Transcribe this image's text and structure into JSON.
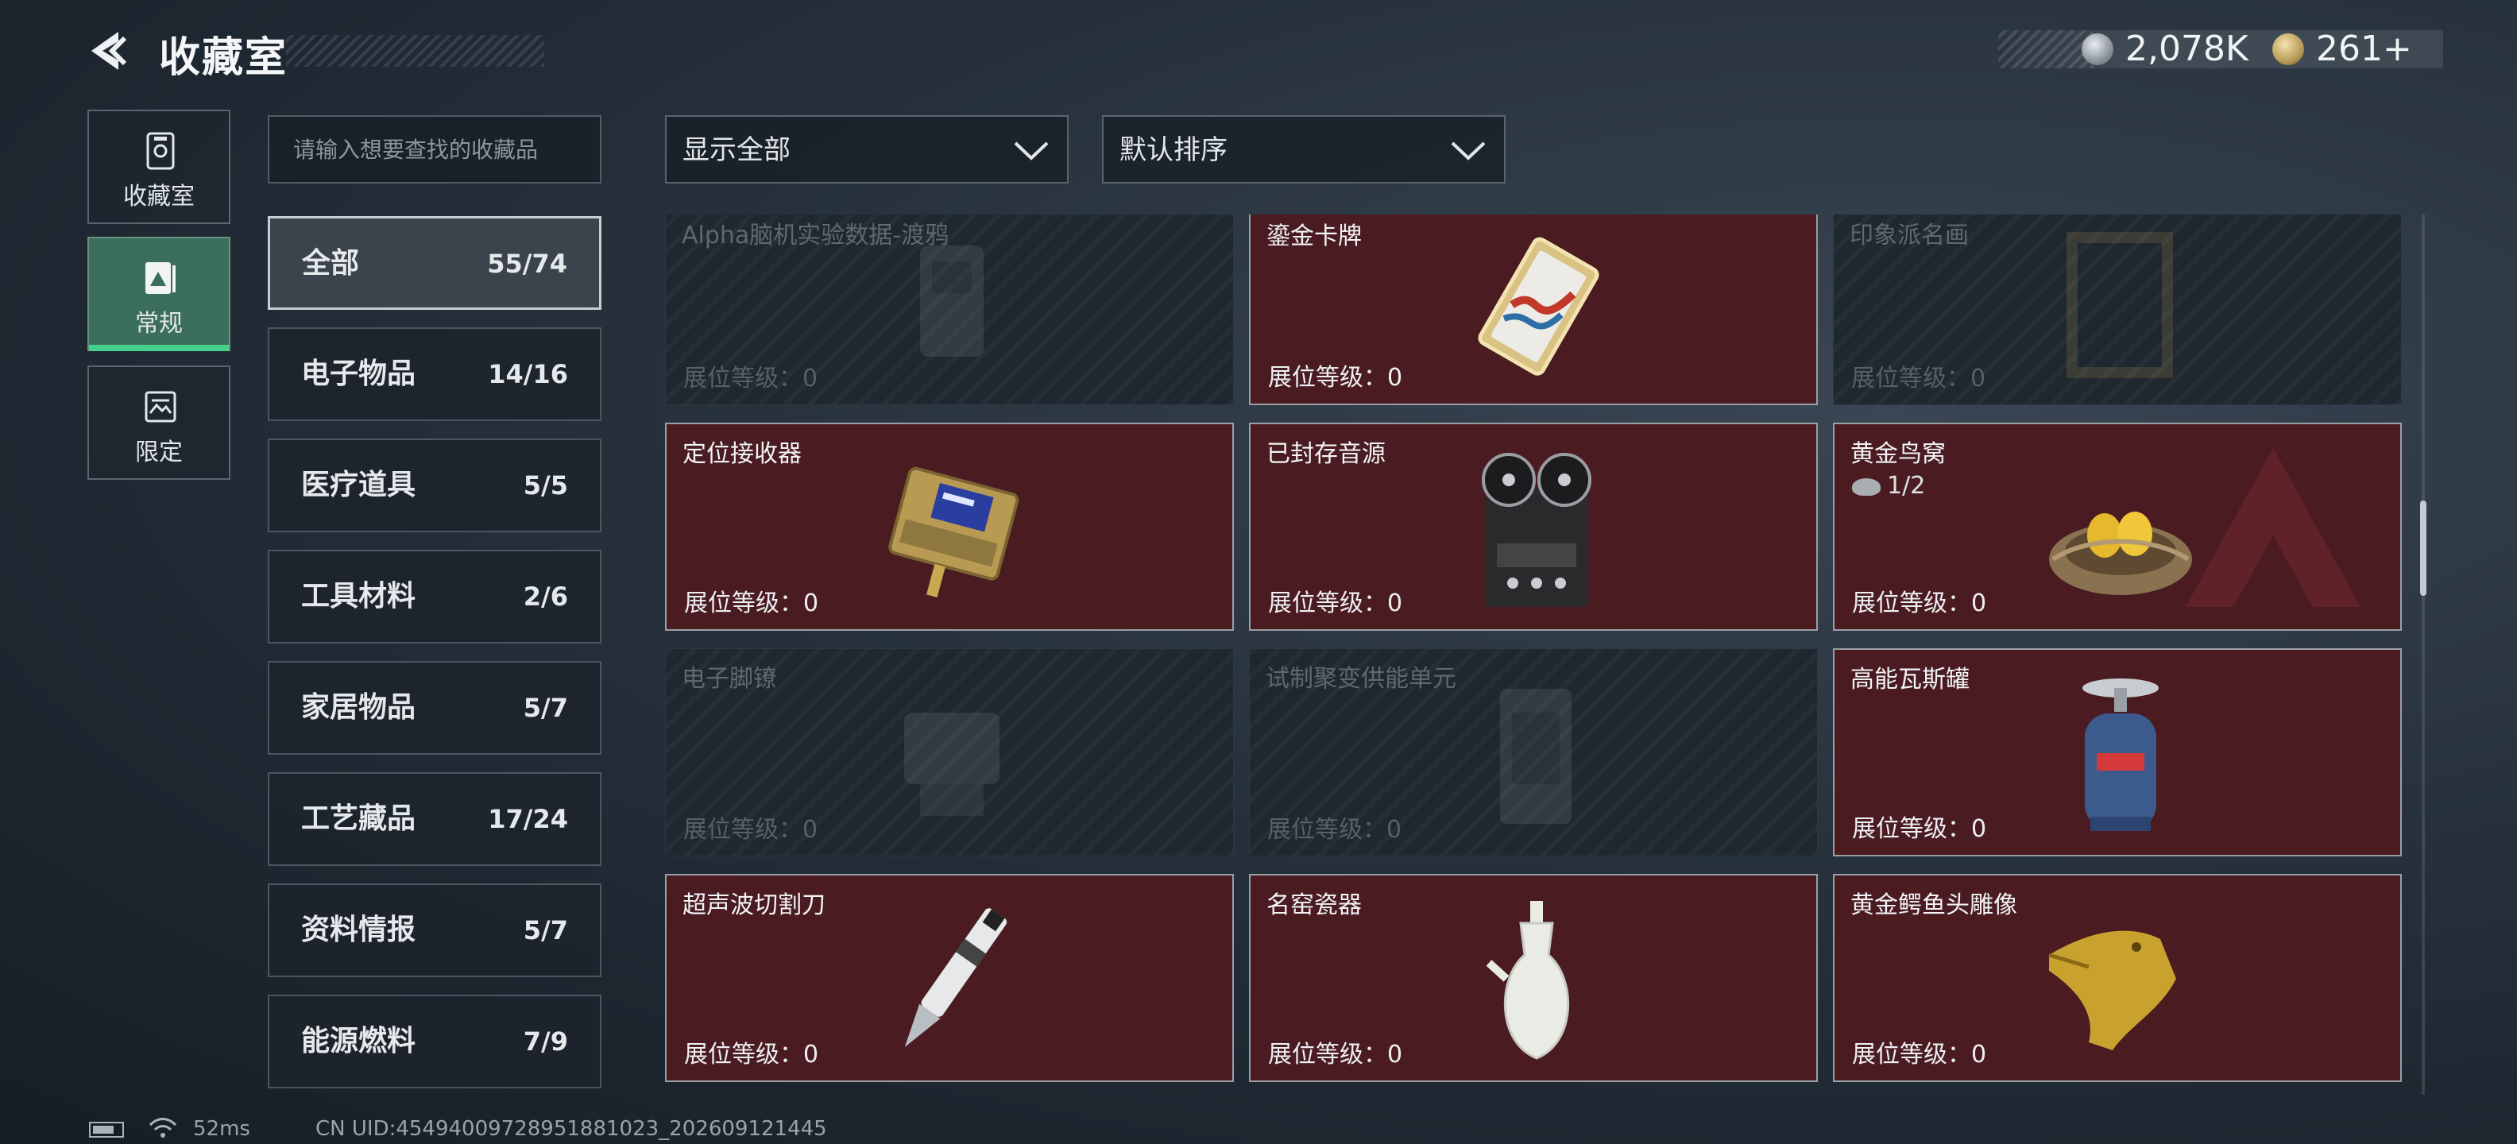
{
  "header": {
    "title": "收藏室",
    "currency": {
      "silver": "2,078K",
      "gold": "261+"
    }
  },
  "nav_tabs": [
    {
      "label": "收藏室",
      "icon": "collection-icon"
    },
    {
      "label": "常规",
      "icon": "regular-icon",
      "active": true
    },
    {
      "label": "限定",
      "icon": "limited-icon"
    }
  ],
  "search": {
    "placeholder": "请输入想要查找的收藏品"
  },
  "categories": [
    {
      "name": "全部",
      "count": "55/74"
    },
    {
      "name": "电子物品",
      "count": "14/16"
    },
    {
      "name": "医疗道具",
      "count": "5/5"
    },
    {
      "name": "工具材料",
      "count": "2/6"
    },
    {
      "name": "家居物品",
      "count": "5/7"
    },
    {
      "name": "工艺藏品",
      "count": "17/24"
    },
    {
      "name": "资料情报",
      "count": "5/7"
    },
    {
      "name": "能源燃料",
      "count": "7/9"
    }
  ],
  "filters": {
    "show": "显示全部",
    "sort": "默认排序"
  },
  "items": [
    {
      "name": "Alpha脑机实验数据-渡鸦",
      "level": "展位等级：0",
      "owned": false,
      "icon": "data-drive-icon"
    },
    {
      "name": "鎏金卡牌",
      "level": "展位等级：0",
      "owned": true,
      "icon": "gilded-card-icon"
    },
    {
      "name": "印象派名画",
      "level": "展位等级：0",
      "owned": false,
      "icon": "painting-icon"
    },
    {
      "name": "定位接收器",
      "level": "展位等级：0",
      "owned": true,
      "icon": "receiver-icon"
    },
    {
      "name": "已封存音源",
      "level": "展位等级：0",
      "owned": true,
      "icon": "tape-recorder-icon"
    },
    {
      "name": "黄金鸟窝",
      "level": "展位等级：0",
      "owned": true,
      "icon": "golden-nest-icon",
      "progress": "1/2"
    },
    {
      "name": "电子脚镣",
      "level": "展位等级：0",
      "owned": false,
      "icon": "ankle-monitor-icon"
    },
    {
      "name": "试制聚变供能单元",
      "level": "展位等级：0",
      "owned": false,
      "icon": "fusion-unit-icon"
    },
    {
      "name": "高能瓦斯罐",
      "level": "展位等级：0",
      "owned": true,
      "icon": "gas-tank-icon"
    },
    {
      "name": "超声波切割刀",
      "level": "展位等级：0",
      "owned": true,
      "icon": "cutter-icon"
    },
    {
      "name": "名窑瓷器",
      "level": "展位等级：0",
      "owned": true,
      "icon": "porcelain-icon"
    },
    {
      "name": "黄金鳄鱼头雕像",
      "level": "展位等级：0",
      "owned": true,
      "icon": "croc-statue-icon"
    }
  ],
  "footer": {
    "ping": "52ms",
    "uid": "CN UID:45494009728951881023_202609121445"
  },
  "colors": {
    "owned_card": "#4a1c22",
    "locked_card": "#1f272f",
    "active_tab": "#3c6e5c",
    "accent_green": "#46d08a"
  }
}
